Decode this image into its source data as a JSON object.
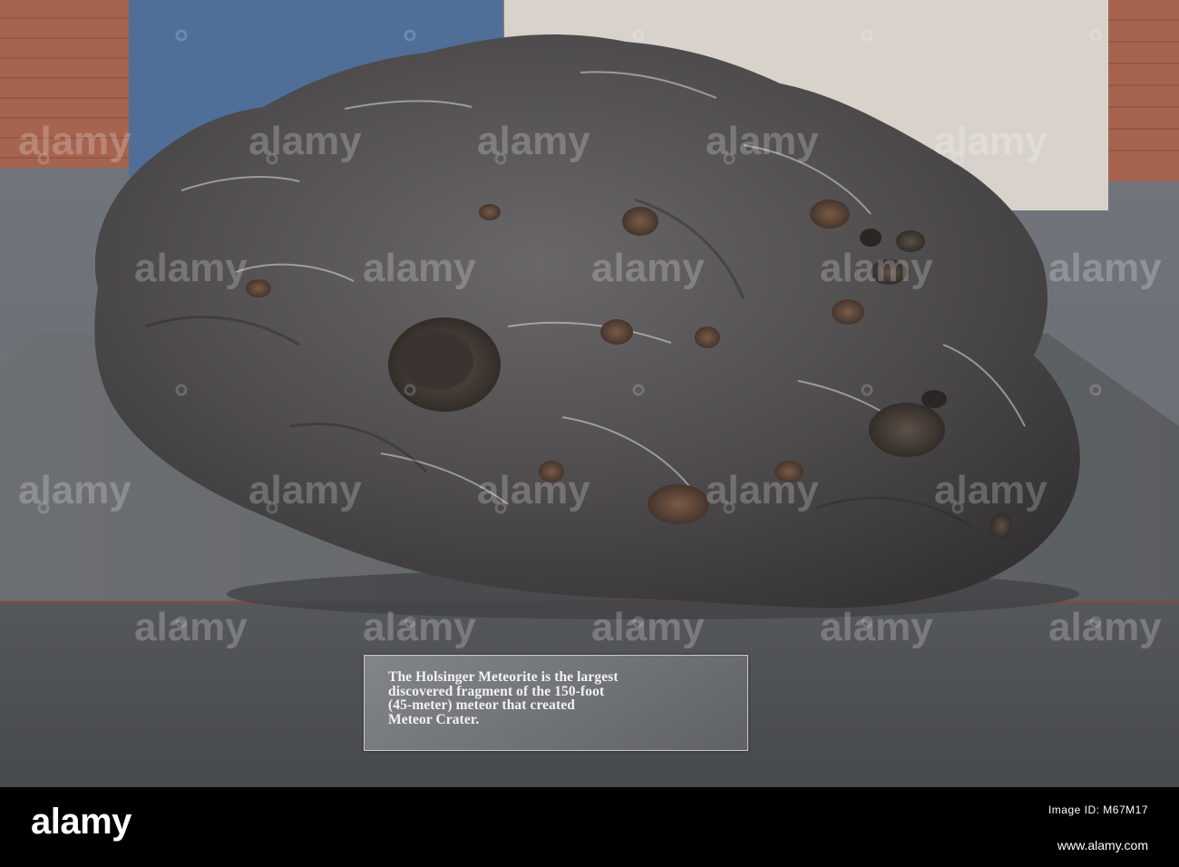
{
  "placard": {
    "lines": [
      "The Holsinger Meteorite is the largest",
      "discovered fragment of the 150-foot",
      "(45-meter) meteor that created",
      "Meteor Crater."
    ]
  },
  "watermark": {
    "text": "alamy"
  },
  "footer": {
    "logo": "alamy",
    "image_id_label": "Image ID: M67M17",
    "image_id": "",
    "url": "www.alamy.com"
  },
  "colors": {
    "pedestal_top": "#5a5d60",
    "pedestal_front": "#4e5154",
    "meteorite": "#4d4b4d",
    "background_panel": "#d8d2cb",
    "blue_panel": "#4f6f98",
    "brick": "#a6644e",
    "footer": "#000000"
  }
}
